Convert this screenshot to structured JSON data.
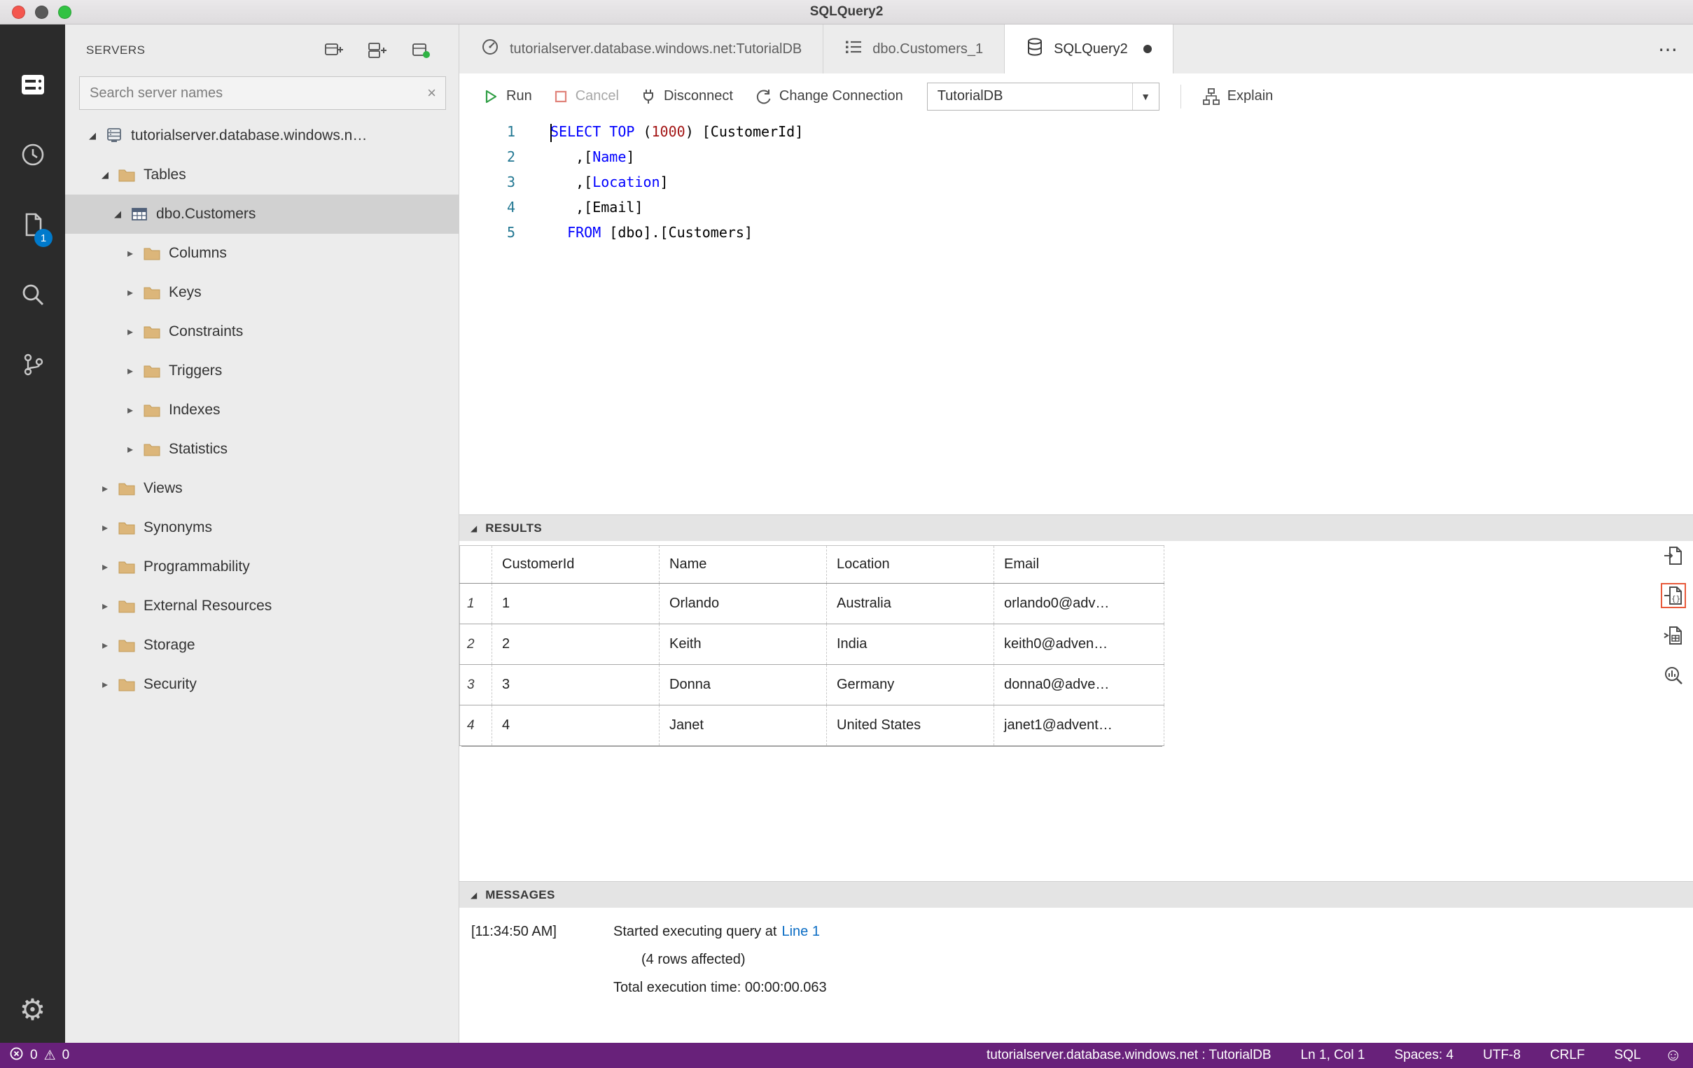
{
  "window": {
    "title": "SQLQuery2"
  },
  "traffic_lights": {
    "close": "#f4564e",
    "minimize": "#595959",
    "zoom": "#32c243"
  },
  "activity_bar": {
    "badge": "1"
  },
  "icons": {
    "gear": "⚙",
    "overflow": "⋯",
    "caret_down": "▼",
    "close_small": "×",
    "warning": "⚠",
    "smiley": "☺",
    "twistie_expanded": "◢",
    "tree_collapsed": "▸"
  },
  "sidebar": {
    "title": "SERVERS",
    "search": {
      "placeholder": "Search server names"
    },
    "tree": [
      {
        "label": "tutorialserver.database.windows.n…",
        "level": 0,
        "icon": "server",
        "arrow": "expanded",
        "selected": false
      },
      {
        "label": "Tables",
        "level": 1,
        "icon": "folder",
        "arrow": "expanded",
        "selected": false
      },
      {
        "label": "dbo.Customers",
        "level": 2,
        "icon": "table",
        "arrow": "expanded",
        "selected": true
      },
      {
        "label": "Columns",
        "level": 3,
        "icon": "folder",
        "arrow": "collapsed",
        "selected": false
      },
      {
        "label": "Keys",
        "level": 3,
        "icon": "folder",
        "arrow": "collapsed",
        "selected": false
      },
      {
        "label": "Constraints",
        "level": 3,
        "icon": "folder",
        "arrow": "collapsed",
        "selected": false
      },
      {
        "label": "Triggers",
        "level": 3,
        "icon": "folder",
        "arrow": "collapsed",
        "selected": false
      },
      {
        "label": "Indexes",
        "level": 3,
        "icon": "folder",
        "arrow": "collapsed",
        "selected": false
      },
      {
        "label": "Statistics",
        "level": 3,
        "icon": "folder",
        "arrow": "collapsed",
        "selected": false
      },
      {
        "label": "Views",
        "level": 1,
        "icon": "folder",
        "arrow": "collapsed",
        "selected": false
      },
      {
        "label": "Synonyms",
        "level": 1,
        "icon": "folder",
        "arrow": "collapsed",
        "selected": false
      },
      {
        "label": "Programmability",
        "level": 1,
        "icon": "folder",
        "arrow": "collapsed",
        "selected": false
      },
      {
        "label": "External Resources",
        "level": 1,
        "icon": "folder",
        "arrow": "collapsed",
        "selected": false
      },
      {
        "label": "Storage",
        "level": 1,
        "icon": "folder",
        "arrow": "collapsed",
        "selected": false
      },
      {
        "label": "Security",
        "level": 1,
        "icon": "folder",
        "arrow": "collapsed",
        "selected": false
      }
    ]
  },
  "tabs": {
    "items": [
      {
        "label": "tutorialserver.database.windows.net:TutorialDB",
        "icon": "dashboard",
        "active": false,
        "dirty": false
      },
      {
        "label": "dbo.Customers_1",
        "icon": "table-list",
        "active": false,
        "dirty": false
      },
      {
        "label": "SQLQuery2",
        "icon": "database",
        "active": true,
        "dirty": true
      }
    ]
  },
  "toolbar": {
    "run": "Run",
    "cancel": "Cancel",
    "disconnect": "Disconnect",
    "change_connection": "Change Connection",
    "database_dropdown": "TutorialDB",
    "explain": "Explain"
  },
  "editor": {
    "token_colors": {
      "kw": "#0000ff",
      "num": "#a31515",
      "plain": "#000000"
    },
    "cursor": {
      "line": "1",
      "col": "1"
    },
    "lines": [
      {
        "num": "1",
        "tokens": [
          {
            "c": "kw",
            "t": "SELECT TOP"
          },
          {
            "c": "plain",
            "t": " ("
          },
          {
            "c": "num",
            "t": "1000"
          },
          {
            "c": "plain",
            "t": ") [CustomerId]"
          }
        ]
      },
      {
        "num": "2",
        "tokens": [
          {
            "c": "plain",
            "t": "   ,["
          },
          {
            "c": "kw",
            "t": "Name"
          },
          {
            "c": "plain",
            "t": "]"
          }
        ]
      },
      {
        "num": "3",
        "tokens": [
          {
            "c": "plain",
            "t": "   ,["
          },
          {
            "c": "kw",
            "t": "Location"
          },
          {
            "c": "plain",
            "t": "]"
          }
        ]
      },
      {
        "num": "4",
        "tokens": [
          {
            "c": "plain",
            "t": "   ,[Email]"
          }
        ]
      },
      {
        "num": "5",
        "tokens": [
          {
            "c": "plain",
            "t": "  "
          },
          {
            "c": "kw",
            "t": "FROM"
          },
          {
            "c": "plain",
            "t": " [dbo].[Customers]"
          }
        ]
      }
    ]
  },
  "results": {
    "title": "RESULTS",
    "columns": [
      "CustomerId",
      "Name",
      "Location",
      "Email"
    ],
    "rows": [
      {
        "num": "1",
        "cells": [
          "1",
          "Orlando",
          "Australia",
          "orlando0@adv…"
        ]
      },
      {
        "num": "2",
        "cells": [
          "2",
          "Keith",
          "India",
          "keith0@adven…"
        ]
      },
      {
        "num": "3",
        "cells": [
          "3",
          "Donna",
          "Germany",
          "donna0@adve…"
        ]
      },
      {
        "num": "4",
        "cells": [
          "4",
          "Janet",
          "United States",
          "janet1@advent…"
        ]
      }
    ]
  },
  "messages": {
    "title": "MESSAGES",
    "lines": [
      {
        "time": "[11:34:50 AM]",
        "text": "Started executing query at",
        "link": "Line 1",
        "indent": 0
      },
      {
        "time": "",
        "text": "(4 rows affected)",
        "link": "",
        "indent": 1
      },
      {
        "time": "",
        "text": "Total execution time: 00:00:00.063",
        "link": "",
        "indent": 0
      }
    ]
  },
  "status_bar": {
    "errors": "0",
    "warnings": "0",
    "items": [
      "tutorialserver.database.windows.net : TutorialDB",
      "Ln 1, Col 1",
      "Spaces: 4",
      "UTF-8",
      "CRLF",
      "SQL"
    ],
    "background": "#68217a"
  }
}
